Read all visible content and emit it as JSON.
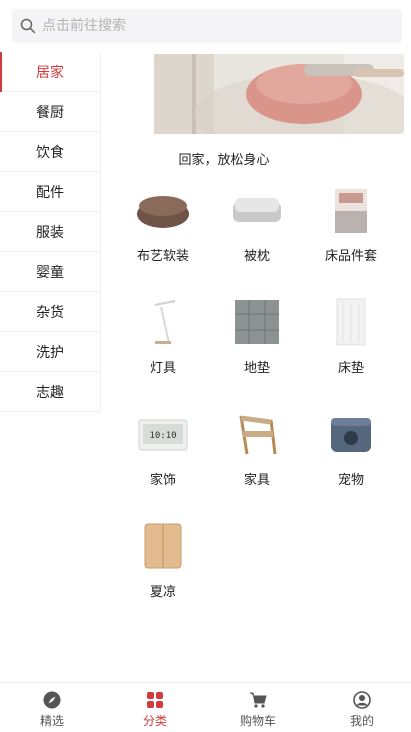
{
  "search": {
    "placeholder": "点击前往搜索"
  },
  "sidebar": {
    "items": [
      {
        "label": "居家",
        "active": true
      },
      {
        "label": "餐厨",
        "active": false
      },
      {
        "label": "饮食",
        "active": false
      },
      {
        "label": "配件",
        "active": false
      },
      {
        "label": "服装",
        "active": false
      },
      {
        "label": "婴童",
        "active": false
      },
      {
        "label": "杂货",
        "active": false
      },
      {
        "label": "洗护",
        "active": false
      },
      {
        "label": "志趣",
        "active": false
      }
    ]
  },
  "banner": {
    "caption": "回家，放松身心"
  },
  "categories": [
    {
      "label": "布艺软装",
      "icon": "beanbag-icon"
    },
    {
      "label": "被枕",
      "icon": "pillow-icon"
    },
    {
      "label": "床品件套",
      "icon": "bedding-set-icon"
    },
    {
      "label": "灯具",
      "icon": "lamp-icon"
    },
    {
      "label": "地垫",
      "icon": "floor-mat-icon"
    },
    {
      "label": "床垫",
      "icon": "mattress-icon"
    },
    {
      "label": "家饰",
      "icon": "clock-icon"
    },
    {
      "label": "家具",
      "icon": "chair-icon"
    },
    {
      "label": "宠物",
      "icon": "pet-house-icon"
    },
    {
      "label": "夏凉",
      "icon": "summer-mat-icon"
    }
  ],
  "tabbar": {
    "items": [
      {
        "label": "精选",
        "icon": "compass-icon"
      },
      {
        "label": "分类",
        "icon": "category-grid-icon",
        "active": true
      },
      {
        "label": "购物车",
        "icon": "cart-icon"
      },
      {
        "label": "我的",
        "icon": "user-icon"
      }
    ]
  },
  "colors": {
    "accent": "#d23b3b",
    "text": "#222222",
    "muted": "#b3b3b3"
  }
}
